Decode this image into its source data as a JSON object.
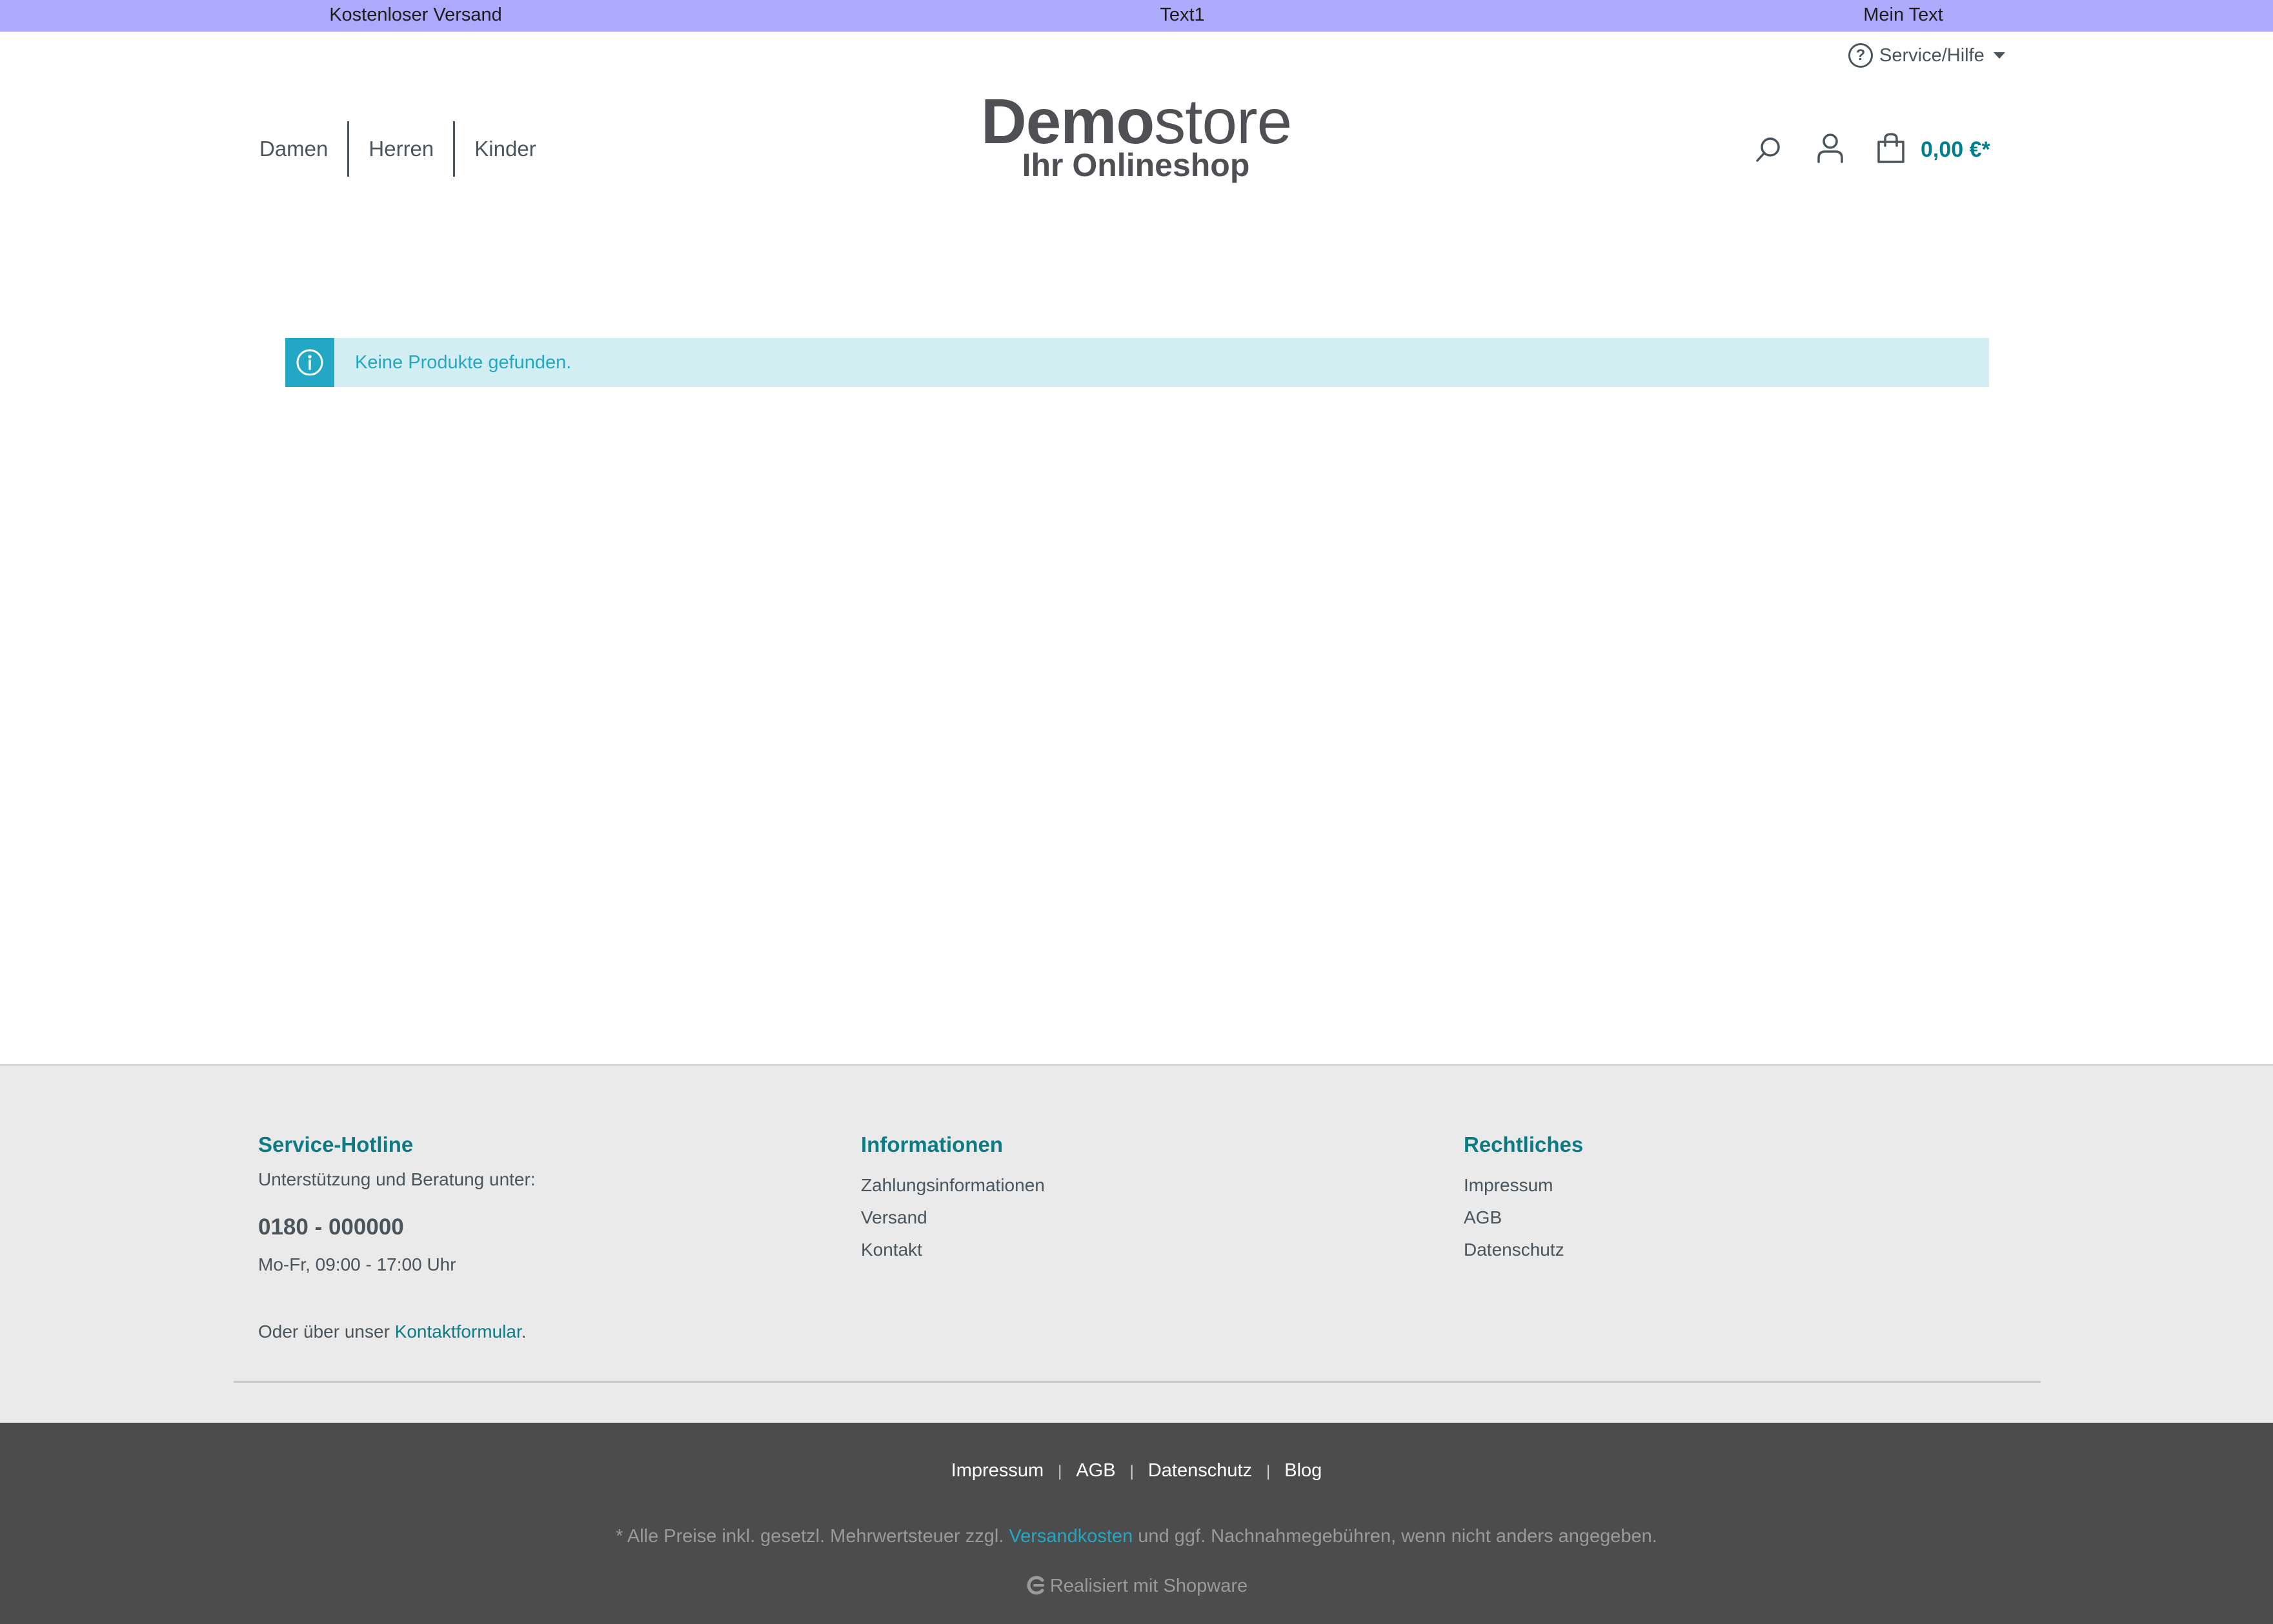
{
  "promo_bar": {
    "left": "Kostenloser Versand",
    "center": "Text1",
    "right": "Mein Text"
  },
  "service": {
    "label": "Service/Hilfe",
    "icon": "question-circle-icon"
  },
  "nav": {
    "items": [
      "Damen",
      "Herren",
      "Kinder"
    ]
  },
  "logo": {
    "bold": "Demo",
    "light": "store",
    "tagline": "Ihr Onlineshop"
  },
  "header": {
    "cart_total": "0,00 €*"
  },
  "alert": {
    "message": "Keine Produkte gefunden.",
    "icon": "info-icon"
  },
  "footer": {
    "service": {
      "title": "Service-Hotline",
      "intro": "Unterstützung und Beratung unter:",
      "phone": "0180 - 000000",
      "hours": "Mo-Fr, 09:00 - 17:00 Uhr",
      "contact_prefix": "Oder über unser ",
      "contact_link": "Kontaktformular",
      "contact_suffix": "."
    },
    "info": {
      "title": "Informationen",
      "links": [
        "Zahlungsinformationen",
        "Versand",
        "Kontakt"
      ]
    },
    "legal": {
      "title": "Rechtliches",
      "links": [
        "Impressum",
        "AGB",
        "Datenschutz"
      ]
    },
    "bottom_links": [
      "Impressum",
      "AGB",
      "Datenschutz",
      "Blog"
    ],
    "separator": "|",
    "vat_prefix": "* Alle Preise inkl. gesetzl. Mehrwertsteuer zzgl. ",
    "vat_link": "Versandkosten",
    "vat_suffix": " und ggf. Nachnahmegebühren, wenn nicht anders angegeben.",
    "made_with": "Realisiert mit Shopware"
  },
  "colors": {
    "promo_bg": "#aeaafb",
    "accent": "#0b7b84",
    "info": "#22a8c4",
    "info_bg": "#d3eef2",
    "footer_bg": "#ebeaeb",
    "footer_bottom_bg": "#4c4c4c"
  }
}
